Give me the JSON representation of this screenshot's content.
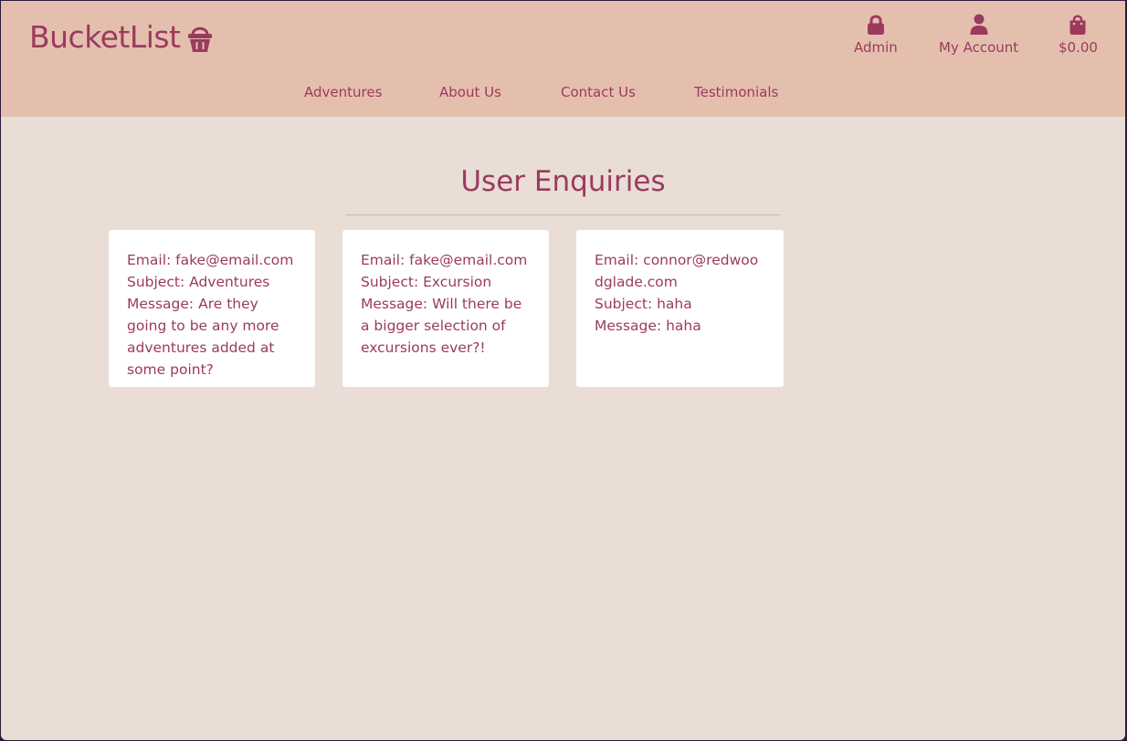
{
  "header": {
    "brand": "BucketList",
    "brand_icon": "shopping-basket-icon",
    "account_nav": [
      {
        "label": "Admin",
        "icon": "lock-icon"
      },
      {
        "label": "My Account",
        "icon": "user-icon"
      },
      {
        "label": "$0.00",
        "icon": "shopping-bag-icon"
      }
    ],
    "main_nav": [
      {
        "label": "Adventures"
      },
      {
        "label": "About Us"
      },
      {
        "label": "Contact Us"
      },
      {
        "label": "Testimonials"
      }
    ]
  },
  "main": {
    "title": "User Enquiries",
    "enquiries": [
      {
        "email_label": "Email:",
        "email": "fake@email.com",
        "subject_label": "Subject:",
        "subject": "Adventures",
        "message_label": "Message:",
        "message": "Are they going to be any more adventures added at some point?"
      },
      {
        "email_label": "Email:",
        "email": "fake@email.com",
        "subject_label": "Subject:",
        "subject": "Excursion",
        "message_label": "Message:",
        "message": "Will there be a bigger selection of excursions ever?!"
      },
      {
        "email_label": "Email:",
        "email": "connor@redwoodglade.com",
        "subject_label": "Subject:",
        "subject": "haha",
        "message_label": "Message:",
        "message": "haha"
      }
    ]
  },
  "colors": {
    "accent": "#9b3a5e",
    "header_bg": "#e5bfae",
    "page_bg": "#e9ddd6",
    "card_bg": "#ffffff"
  }
}
